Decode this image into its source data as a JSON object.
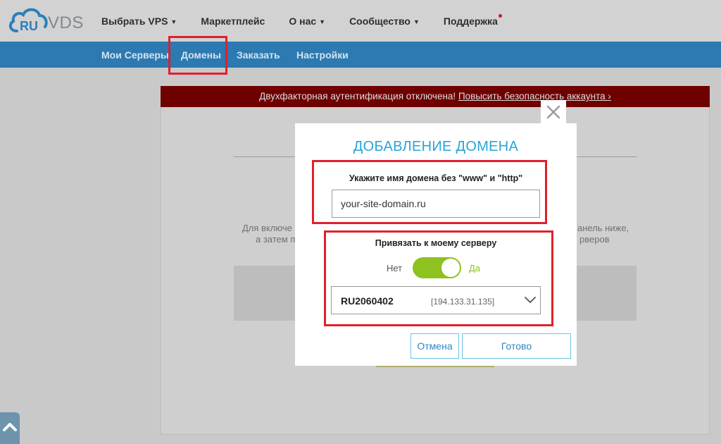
{
  "logo": {
    "brand_main": "RU",
    "brand_suffix": "VDS"
  },
  "top_nav": [
    {
      "label": "Выбрать VPS",
      "has_dropdown": true
    },
    {
      "label": "Маркетплейс",
      "has_dropdown": false
    },
    {
      "label": "О нас",
      "has_dropdown": true
    },
    {
      "label": "Сообщество",
      "has_dropdown": true
    },
    {
      "label": "Поддержка",
      "has_dropdown": false,
      "notification_dot": true
    }
  ],
  "sub_nav": [
    {
      "label": "Мои Серверы",
      "active": false
    },
    {
      "label": "Домены",
      "active": true
    },
    {
      "label": "Заказать",
      "active": false
    },
    {
      "label": "Настройки",
      "active": false
    }
  ],
  "alert": {
    "text": "Двухфакторная аутентификация отключена!",
    "link": "Повысить безопасность аккаунта ›"
  },
  "background_text": {
    "line1_left": "Для включе",
    "line1_right": "анель ниже,",
    "line2_left": "а затем п",
    "line2_right": "рверов"
  },
  "modal": {
    "title": "ДОБАВЛЕНИЕ ДОМЕНА",
    "domain_label": "Укажите имя домена без \"www\" и \"http\"",
    "domain_value": "your-site-domain.ru",
    "bind_label": "Привязать к моему серверу",
    "toggle_off_label": "Нет",
    "toggle_on_label": "Да",
    "toggle_state": "on",
    "server_id": "RU2060402",
    "server_ip": "[194.133.31.135]",
    "cancel_label": "Отмена",
    "confirm_label": "Готово"
  },
  "colors": {
    "brand_blue": "#2c7ab1",
    "accent_cyan": "#27a4d8",
    "toggle_green": "#8dc21f",
    "alert_red": "#6e0000",
    "highlight_red": "#e0202c"
  },
  "icons": {
    "logo": "cloud-logo-icon",
    "close": "close-icon",
    "select": "chevron-down-icon",
    "scroll": "chevron-up-icon"
  }
}
